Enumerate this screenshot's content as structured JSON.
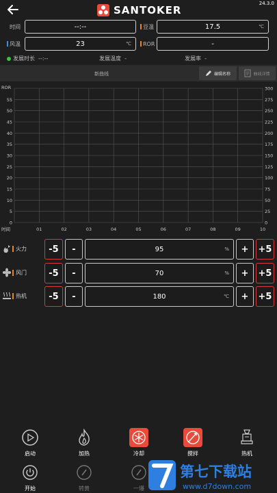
{
  "app": {
    "brand": "SANTOKER",
    "version": "24.3.0"
  },
  "fields": {
    "time": {
      "label": "时间",
      "value": "--:--"
    },
    "bean_temp": {
      "label": "豆温",
      "value": "17.5",
      "unit": "℃",
      "accent": "#e8872a"
    },
    "air_temp": {
      "label": "风温",
      "value": "23",
      "unit": "℃",
      "accent": "#3a8ee8"
    },
    "ror": {
      "label": "ROR",
      "value": "-",
      "accent": "#e8872a"
    }
  },
  "status": {
    "duration_label": "发展时长",
    "duration_value": "--:--",
    "temp_label": "发展温度",
    "temp_value": "-",
    "rate_label": "发展率",
    "rate_value": "-",
    "connected_color": "#3cc43c"
  },
  "curve": {
    "name": "新曲线",
    "edit_label": "编辑名称",
    "detail_label": "曲线详情"
  },
  "chart_data": {
    "type": "line",
    "left_axis_label": "ROR",
    "left_ticks": [
      "55",
      "50",
      "45",
      "40",
      "35",
      "30",
      "25",
      "20",
      "15",
      "10",
      "5",
      "0"
    ],
    "right_ticks": [
      "300",
      "275",
      "250",
      "225",
      "200",
      "175",
      "150",
      "125",
      "100",
      "75",
      "50",
      "25",
      "0"
    ],
    "x_label": "时间",
    "x_ticks": [
      "01",
      "02",
      "03",
      "04",
      "05",
      "06",
      "07",
      "08",
      "09",
      "10"
    ],
    "series": [],
    "grid": true
  },
  "controls": [
    {
      "key": "fire",
      "label": "火力",
      "value": "95",
      "unit": "%",
      "icon": "flame-fan-icon",
      "buttons": {
        "big_minus": "-5",
        "minus": "-",
        "plus": "+",
        "big_plus": "+5"
      }
    },
    {
      "key": "damper",
      "label": "风门",
      "value": "70",
      "unit": "%",
      "icon": "fan-icon",
      "buttons": {
        "big_minus": "-5",
        "minus": "-",
        "plus": "+",
        "big_plus": "+5"
      }
    },
    {
      "key": "heater",
      "label": "热机",
      "value": "180",
      "unit": "℃",
      "icon": "heat-icon",
      "buttons": {
        "big_minus": "-5",
        "minus": "-",
        "plus": "+",
        "big_plus": "+5"
      }
    }
  ],
  "bottom": {
    "row1": [
      {
        "label": "启动",
        "icon": "play-icon"
      },
      {
        "label": "加热",
        "icon": "flame-icon"
      },
      {
        "label": "冷却",
        "icon": "snowflake-icon"
      },
      {
        "label": "搅拌",
        "icon": "stir-icon"
      },
      {
        "label": "热机",
        "icon": "machine-icon"
      }
    ],
    "row2": [
      {
        "label": "开始",
        "icon": "power-icon"
      },
      {
        "label": "转黄",
        "icon": "compass-icon"
      },
      {
        "label": "一爆",
        "icon": "compass-icon"
      }
    ]
  },
  "watermark": {
    "text_cn": "第七下载站",
    "url": "www.d7down.com"
  }
}
